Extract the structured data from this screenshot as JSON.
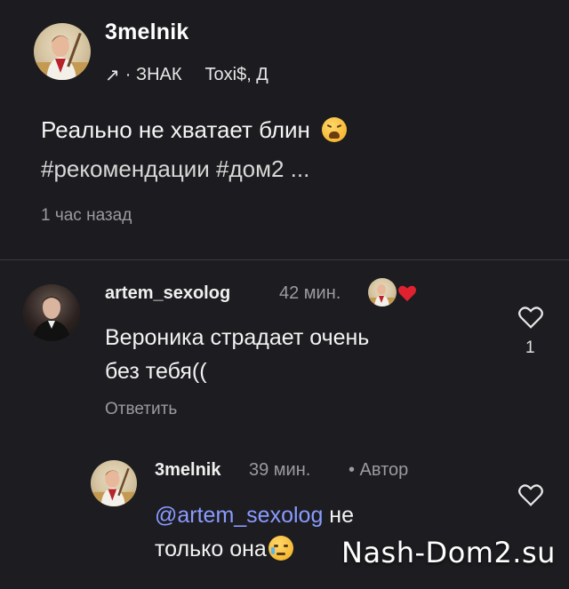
{
  "post": {
    "author": "3melnik",
    "meta_arrow": "↗",
    "meta_group": "· ЗНАК",
    "meta_tags": "Toxi$, Д",
    "text_line1": "Реально не хватает блин",
    "text_line2": "#рекомендации #дом2 ...",
    "time": "1 час назад"
  },
  "comments": [
    {
      "author": "artem_sexolog",
      "time": "42 мин.",
      "text_line1": "Вероника страдает очень",
      "text_line2": "без тебя((",
      "reply_label": "Ответить",
      "like_count": "1"
    },
    {
      "author": "3melnik",
      "time": "39 мин.",
      "badge": "• Автор",
      "mention": "@artem_sexolog",
      "text_line1_rest": " не",
      "text_line2": "только она"
    }
  ],
  "watermark": "Nash-Dom2.su",
  "colors": {
    "background": "#1c1c20",
    "mention": "#8a9bff",
    "secondary_text": "#9a9aa0",
    "liked_heart": "#e0212f"
  },
  "icons": [
    "share-arrow-icon",
    "weary-face-emoji-icon",
    "heart-icon",
    "liked-heart-icon",
    "crying-face-emoji-icon"
  ]
}
